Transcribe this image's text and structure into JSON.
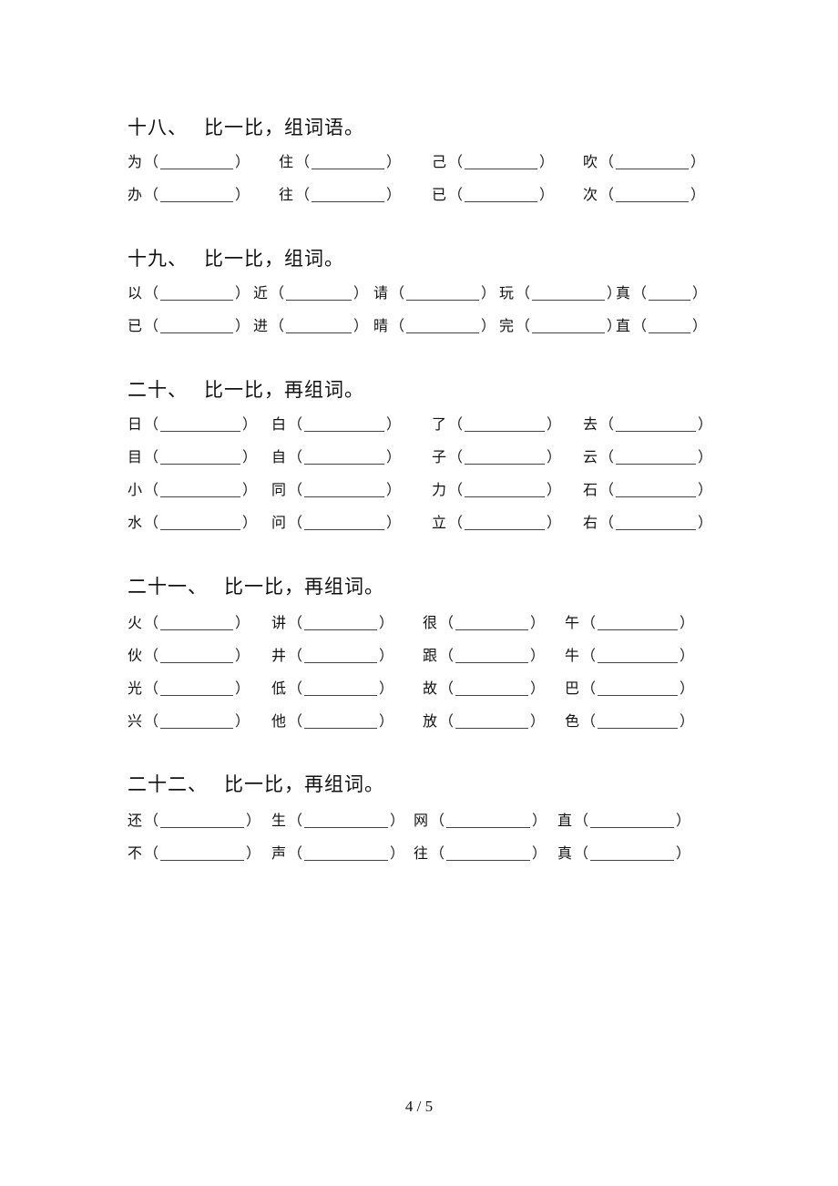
{
  "sections": [
    {
      "number": "十八、",
      "instruction": "比一比，组词语。",
      "rows": [
        [
          "为",
          "住",
          "己",
          "吹"
        ],
        [
          "办",
          "往",
          "已",
          "次"
        ]
      ]
    },
    {
      "number": "十九、",
      "instruction": "比一比，组词。",
      "rows": [
        [
          "以",
          "近",
          "请",
          "玩",
          "真"
        ],
        [
          "已",
          "进",
          "晴",
          "完",
          "直"
        ]
      ]
    },
    {
      "number": "二十、",
      "instruction": "比一比，再组词。",
      "rows": [
        [
          "日",
          "白",
          "了",
          "去"
        ],
        [
          "目",
          "自",
          "子",
          "云"
        ],
        [
          "小",
          "同",
          "力",
          "石"
        ],
        [
          "水",
          "问",
          "立",
          "右"
        ]
      ]
    },
    {
      "number": "二十一、",
      "instruction": "比一比，再组词。",
      "rows": [
        [
          "火",
          "讲",
          "很",
          "午"
        ],
        [
          "伙",
          "井",
          "跟",
          "牛"
        ],
        [
          "光",
          "低",
          "故",
          "巴"
        ],
        [
          "兴",
          "他",
          "放",
          "色"
        ]
      ]
    },
    {
      "number": "二十二、",
      "instruction": "比一比，再组词。",
      "rows": [
        [
          "还",
          "生",
          "网",
          "直"
        ],
        [
          "不",
          "声",
          "往",
          "真"
        ]
      ]
    }
  ],
  "symbols": {
    "open_paren": "（",
    "close_paren": "）"
  },
  "footer": {
    "page_number": "4 / 5"
  }
}
